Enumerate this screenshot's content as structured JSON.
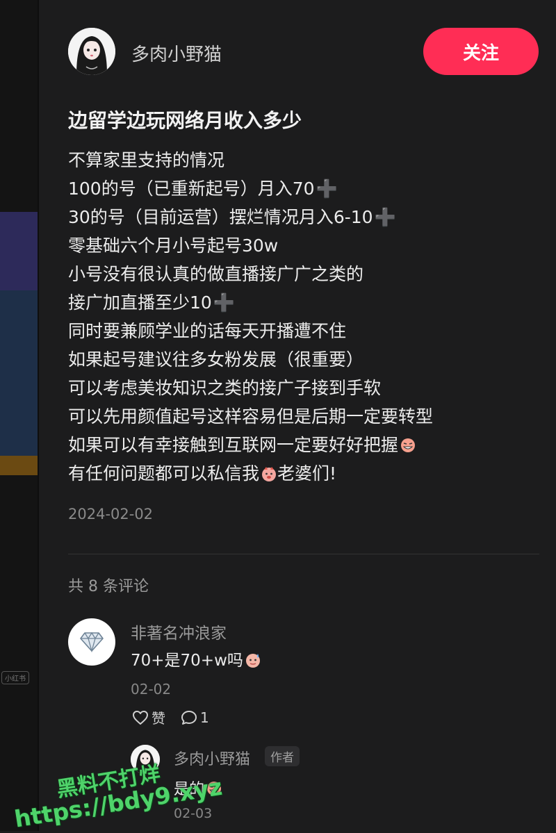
{
  "author": {
    "name": "多肉小野猫",
    "follow_label": "关注"
  },
  "post": {
    "title": "边留学边玩网络月收入多少",
    "lines": [
      {
        "text": "不算家里支持的情况",
        "suffix": ""
      },
      {
        "text": "100的号（已重新起号）月入70",
        "suffix": "plus"
      },
      {
        "text": "30的号（目前运营）摆烂情况月入6-10",
        "suffix": "plus"
      },
      {
        "text": "零基础六个月小号起号30w",
        "suffix": ""
      },
      {
        "text": "小号没有很认真的做直播接广广之类的",
        "suffix": ""
      },
      {
        "text": "接广加直播至少10",
        "suffix": "plus"
      },
      {
        "text": "同时要兼顾学业的话每天开播遭不住",
        "suffix": ""
      },
      {
        "text": "如果起号建议往多女粉发展（很重要）",
        "suffix": ""
      },
      {
        "text": "可以考虑美妆知识之类的接广子接到手软",
        "suffix": ""
      },
      {
        "text": "可以先用颜值起号这样容易但是后期一定要转型",
        "suffix": ""
      },
      {
        "text": "如果可以有幸接触到互联网一定要好好把握",
        "suffix": "emoji"
      },
      {
        "text": "有任何问题都可以私信我",
        "suffix": "emoji",
        "after": "老婆们!"
      }
    ],
    "plus_symbol": "➕",
    "date": "2024-02-02"
  },
  "comments": {
    "count_label": "共 8 条评论",
    "items": [
      {
        "user": "非著名冲浪家",
        "text": "70+是70+w吗",
        "date": "02-02",
        "like_label": "赞",
        "reply_count": "1",
        "avatar_icon": "diamond-icon",
        "reply": {
          "user": "多肉小野猫",
          "badge": "作者",
          "text": "是的",
          "date": "02-03"
        }
      }
    ]
  },
  "watermark": {
    "line1": "黑料不打烊",
    "line2": "https://bdy9.xyz"
  },
  "left_strip": {
    "tag": "小红书"
  },
  "colors": {
    "follow": "#ff2d55",
    "background": "#1c1c1d",
    "watermark": "#4fd36a"
  }
}
